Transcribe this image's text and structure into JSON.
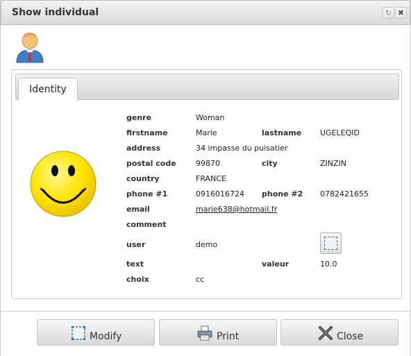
{
  "window": {
    "title": "Show individual",
    "refresh_icon_glyph": "↻",
    "close_icon_glyph": "✖"
  },
  "tabs": [
    {
      "label": "Identity",
      "active": true
    }
  ],
  "fields": {
    "genre": {
      "label": "genre",
      "value": "Woman"
    },
    "firstname": {
      "label": "firstname",
      "value": "Marie"
    },
    "lastname": {
      "label": "lastname",
      "value": "UGELEQID"
    },
    "address": {
      "label": "address",
      "value": "34 impasse du puisatier"
    },
    "postal_code": {
      "label": "postal code",
      "value": "99870"
    },
    "city": {
      "label": "city",
      "value": "ZINZIN"
    },
    "country": {
      "label": "country",
      "value": "FRANCE"
    },
    "phone1": {
      "label": "phone #1",
      "value": "0916016724"
    },
    "phone2": {
      "label": "phone #2",
      "value": "0782421655"
    },
    "email": {
      "label": "email",
      "value": "marie638@hotmail.fr"
    },
    "comment": {
      "label": "comment",
      "value": ""
    },
    "user": {
      "label": "user",
      "value": "demo"
    },
    "text": {
      "label": "text",
      "value": ""
    },
    "valeur": {
      "label": "valeur",
      "value": "10.0"
    },
    "choix": {
      "label": "choix",
      "value": "cc"
    }
  },
  "buttons": {
    "modify": "Modify",
    "print": "Print",
    "close": "Close"
  },
  "colors": {
    "smiley_fill": "#ffe600",
    "icon_blue": "#2b6fb5"
  }
}
